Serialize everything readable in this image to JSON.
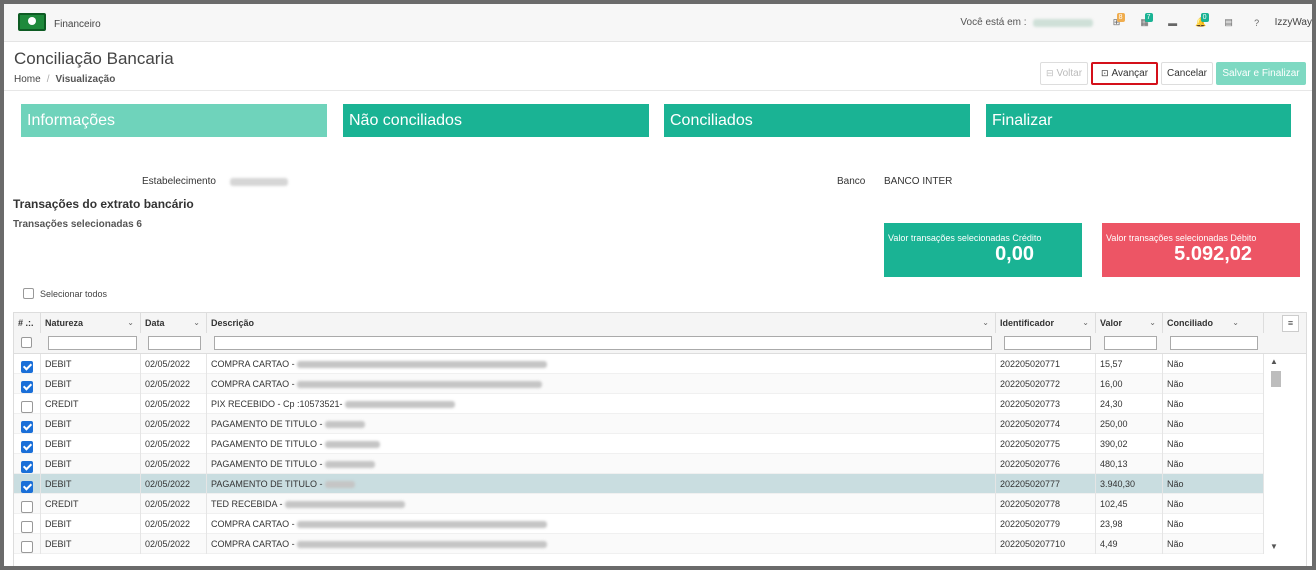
{
  "topbar": {
    "brand_icon": "money-icon",
    "brand_label": "Financeiro",
    "you_are_label": "Você está em :",
    "icons": [
      {
        "name": "sitemap-icon",
        "badge": "8",
        "badge_color": "#f0ad4e"
      },
      {
        "name": "grid-icon",
        "badge": "7",
        "badge_color": "#1ab394"
      },
      {
        "name": "card-icon",
        "badge": "",
        "badge_color": ""
      },
      {
        "name": "bell-icon",
        "badge": "0",
        "badge_color": "#1ab394"
      },
      {
        "name": "calendar-icon",
        "badge": "",
        "badge_color": ""
      },
      {
        "name": "help-icon",
        "badge": "",
        "badge_color": ""
      }
    ],
    "user": "IzzyWay"
  },
  "header": {
    "title": "Conciliação Bancaria",
    "breadcrumb_home": "Home",
    "breadcrumb_current": "Visualização",
    "buttons": {
      "voltar": "Voltar",
      "avancar": "Avançar",
      "cancelar": "Cancelar",
      "salvar": "Salvar e Finalizar"
    }
  },
  "steps": [
    "Informações",
    "Não conciliados",
    "Conciliados",
    "Finalizar"
  ],
  "info": {
    "estabelecimento_label": "Estabelecimento",
    "banco_label": "Banco",
    "banco_value": "BANCO INTER",
    "section_title": "Transações do extrato bancário",
    "selected_label": "Transações selecionadas 6"
  },
  "cards": {
    "credit_label": "Valor transações selecionadas Crédito",
    "credit_value": "0,00",
    "debit_label": "Valor transações selecionadas Débito",
    "debit_value": "5.092,02"
  },
  "select_all_label": "Selecionar todos",
  "table": {
    "headers": {
      "num": "# .:.",
      "natureza": "Natureza",
      "data": "Data",
      "descricao": "Descrição",
      "identificador": "Identificador",
      "valor": "Valor",
      "conciliado": "Conciliado"
    },
    "rows": [
      {
        "checked": true,
        "natureza": "DEBIT",
        "data": "02/05/2022",
        "descricao": "COMPRA CARTAO -",
        "identificador": "202205020771",
        "valor": "15,57",
        "conciliado": "Não",
        "selected": false
      },
      {
        "checked": true,
        "natureza": "DEBIT",
        "data": "02/05/2022",
        "descricao": "COMPRA CARTAO -",
        "identificador": "202205020772",
        "valor": "16,00",
        "conciliado": "Não",
        "selected": false
      },
      {
        "checked": false,
        "natureza": "CREDIT",
        "data": "02/05/2022",
        "descricao": "PIX RECEBIDO - Cp :10573521-",
        "identificador": "202205020773",
        "valor": "24,30",
        "conciliado": "Não",
        "selected": false
      },
      {
        "checked": true,
        "natureza": "DEBIT",
        "data": "02/05/2022",
        "descricao": "PAGAMENTO DE TITULO -",
        "identificador": "202205020774",
        "valor": "250,00",
        "conciliado": "Não",
        "selected": false
      },
      {
        "checked": true,
        "natureza": "DEBIT",
        "data": "02/05/2022",
        "descricao": "PAGAMENTO DE TITULO -",
        "identificador": "202205020775",
        "valor": "390,02",
        "conciliado": "Não",
        "selected": false
      },
      {
        "checked": true,
        "natureza": "DEBIT",
        "data": "02/05/2022",
        "descricao": "PAGAMENTO DE TITULO -",
        "identificador": "202205020776",
        "valor": "480,13",
        "conciliado": "Não",
        "selected": false
      },
      {
        "checked": true,
        "natureza": "DEBIT",
        "data": "02/05/2022",
        "descricao": "PAGAMENTO DE TITULO -",
        "identificador": "202205020777",
        "valor": "3.940,30",
        "conciliado": "Não",
        "selected": true
      },
      {
        "checked": false,
        "natureza": "CREDIT",
        "data": "02/05/2022",
        "descricao": "TED RECEBIDA -",
        "identificador": "202205020778",
        "valor": "102,45",
        "conciliado": "Não",
        "selected": false
      },
      {
        "checked": false,
        "natureza": "DEBIT",
        "data": "02/05/2022",
        "descricao": "COMPRA CARTAO -",
        "identificador": "202205020779",
        "valor": "23,98",
        "conciliado": "Não",
        "selected": false
      },
      {
        "checked": false,
        "natureza": "DEBIT",
        "data": "02/05/2022",
        "descricao": "COMPRA CARTAO -",
        "identificador": "2022050207710",
        "valor": "4,49",
        "conciliado": "Não",
        "selected": false
      }
    ]
  },
  "colors": {
    "primary": "#1ab394",
    "primary_light": "#6fd3bb",
    "danger": "#ed5565",
    "highlight": "#d4101a",
    "checkbox": "#1a6fd8"
  }
}
